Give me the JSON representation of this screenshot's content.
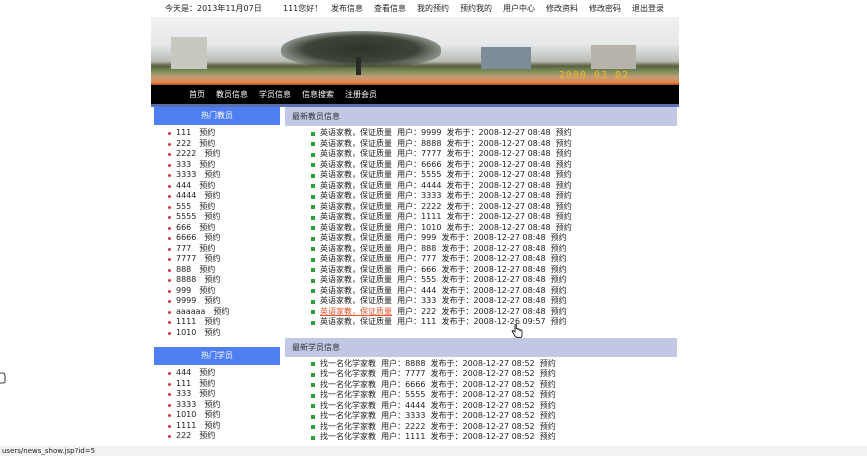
{
  "topbar": {
    "date": "今天是：2013年11月07日",
    "welcome": "111您好！",
    "links": [
      "发布信息",
      "查看信息",
      "我的预约",
      "预约我的",
      "用户中心",
      "修改资料",
      "修改密码",
      "退出登录"
    ]
  },
  "banner": {
    "stamp": "2000 03 02"
  },
  "nav": {
    "links": [
      "首页",
      "教员信息",
      "学员信息",
      "信息搜索",
      "注册会员"
    ]
  },
  "hot_teachers": {
    "title": "热门教员",
    "book": "预约",
    "users": [
      "111",
      "222",
      "2222",
      "333",
      "3333",
      "444",
      "4444",
      "555",
      "5555",
      "666",
      "6666",
      "777",
      "7777",
      "888",
      "8888",
      "999",
      "9999",
      "aaaaaa",
      "1111",
      "1010"
    ]
  },
  "hot_students": {
    "title": "热门学员",
    "book": "预约",
    "users": [
      "444",
      "111",
      "333",
      "3333",
      "1010",
      "1111",
      "222"
    ]
  },
  "teacher_section": {
    "title": "最新教员信息",
    "item_title": "英语家教，保证质量",
    "user_label": "用户：",
    "posted_label": "发布于：",
    "book": "预约",
    "rows": [
      {
        "user": "9999",
        "time": "2008-12-27 08:48"
      },
      {
        "user": "8888",
        "time": "2008-12-27 08:48"
      },
      {
        "user": "7777",
        "time": "2008-12-27 08:48"
      },
      {
        "user": "6666",
        "time": "2008-12-27 08:48"
      },
      {
        "user": "5555",
        "time": "2008-12-27 08:48"
      },
      {
        "user": "4444",
        "time": "2008-12-27 08:48"
      },
      {
        "user": "3333",
        "time": "2008-12-27 08:48"
      },
      {
        "user": "2222",
        "time": "2008-12-27 08:48"
      },
      {
        "user": "1111",
        "time": "2008-12-27 08:48"
      },
      {
        "user": "1010",
        "time": "2008-12-27 08:48"
      },
      {
        "user": "999",
        "time": "2008-12-27 08:48"
      },
      {
        "user": "888",
        "time": "2008-12-27 08:48"
      },
      {
        "user": "777",
        "time": "2008-12-27 08:48"
      },
      {
        "user": "666",
        "time": "2008-12-27 08:48"
      },
      {
        "user": "555",
        "time": "2008-12-27 08:48"
      },
      {
        "user": "444",
        "time": "2008-12-27 08:48"
      },
      {
        "user": "333",
        "time": "2008-12-27 08:48"
      },
      {
        "user": "222",
        "time": "2008-12-27 08:48"
      },
      {
        "user": "111",
        "time": "2008-12-26 09:57"
      }
    ]
  },
  "student_section": {
    "title": "最新学员信息",
    "item_title": "找一名化学家教",
    "user_label": "用户：",
    "posted_label": "发布于：",
    "book": "预约",
    "rows": [
      {
        "user": "8888",
        "time": "2008-12-27 08:52"
      },
      {
        "user": "7777",
        "time": "2008-12-27 08:52"
      },
      {
        "user": "6666",
        "time": "2008-12-27 08:52"
      },
      {
        "user": "5555",
        "time": "2008-12-27 08:52"
      },
      {
        "user": "4444",
        "time": "2008-12-27 08:52"
      },
      {
        "user": "3333",
        "time": "2008-12-27 08:52"
      },
      {
        "user": "2222",
        "time": "2008-12-27 08:52"
      },
      {
        "user": "1111",
        "time": "2008-12-27 08:52"
      }
    ]
  },
  "status": {
    "url": "users/news_show.jsp?id=5"
  },
  "colors": {
    "accent": "#4f7df2",
    "section_bg": "#c1c7e4",
    "link_hover": "#e0522b"
  }
}
